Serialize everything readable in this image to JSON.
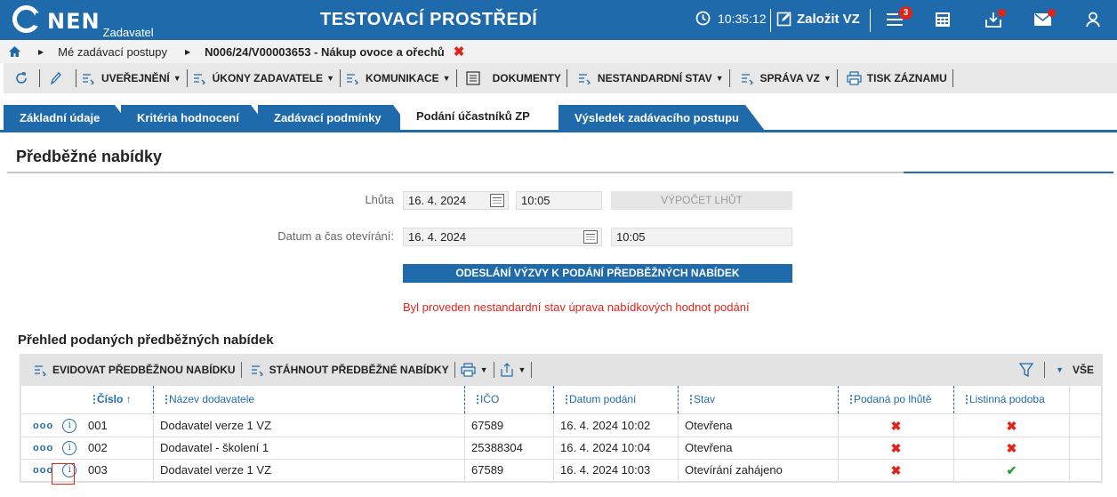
{
  "header": {
    "logo_text": "NEN",
    "logo_sub": "Zadavatel",
    "env_title": "TESTOVACÍ PROSTŘEDÍ",
    "time": "10:35:12",
    "new_label": "Založit VZ",
    "menu_badge": "3"
  },
  "breadcrumb": {
    "item1": "Mé zadávací postupy",
    "item2": "N006/24/V00003653 - Nákup ovoce a ořechů",
    "close": "✖"
  },
  "toolbar": {
    "items": [
      "UVEŘEJNĚNÍ",
      "ÚKONY ZADAVATELE",
      "KOMUNIKACE",
      "DOKUMENTY",
      "NESTANDARDNÍ STAV",
      "SPRÁVA VZ",
      "TISK ZÁZNAMU"
    ]
  },
  "tabs": [
    "Základní údaje",
    "Kritéria hodnocení",
    "Zadávací podmínky",
    "Podání účastníků ZP",
    "Výsledek zadávacího postupu"
  ],
  "section": {
    "title": "Předběžné nabídky",
    "lhuta_label": "Lhůta",
    "lhuta_date": "16. 4. 2024",
    "lhuta_time": "10:05",
    "calc_button": "VÝPOČET LHŮT",
    "open_label": "Datum a čas otevírání:",
    "open_date": "16. 4. 2024",
    "open_time": "10:05",
    "send_button": "ODESLÁNÍ VÝZVY K PODÁNÍ PŘEDBĚŽNÝCH NABÍDEK",
    "warning": "Byl proveden nestandardní stav úprava nabídkových hodnot podání"
  },
  "grid": {
    "title": "Přehled podaných předběžných nabídek",
    "btn_add": "EVIDOVAT PŘEDBĚŽNOU NABÍDKU",
    "btn_download": "STÁHNOUT PŘEDBĚŽNÉ NABÍDKY",
    "all_label": "VŠE",
    "columns": [
      "Číslo",
      "Název dodavatele",
      "IČO",
      "Datum podání",
      "Stav",
      "Podaná po lhůtě",
      "Listinná podoba"
    ],
    "rows": [
      {
        "cislo": "001",
        "nazev": "Dodavatel verze 1 VZ",
        "ico": "67589",
        "datum": "16. 4. 2024 10:02",
        "stav": "Otevřena",
        "po_lhute": "✖",
        "listinna": "✖"
      },
      {
        "cislo": "002",
        "nazev": "Dodavatel - školení 1",
        "ico": "25388304",
        "datum": "16. 4. 2024 10:04",
        "stav": "Otevřena",
        "po_lhute": "✖",
        "listinna": "✖"
      },
      {
        "cislo": "003",
        "nazev": "Dodavatel verze 1 VZ",
        "ico": "67589",
        "datum": "16. 4. 2024 10:03",
        "stav": "Otevírání zahájeno",
        "po_lhute": "✖",
        "listinna": "✔"
      }
    ]
  },
  "colors": {
    "brand": "#1f6aab",
    "danger": "#e2231a",
    "ok": "#2aa23a"
  }
}
